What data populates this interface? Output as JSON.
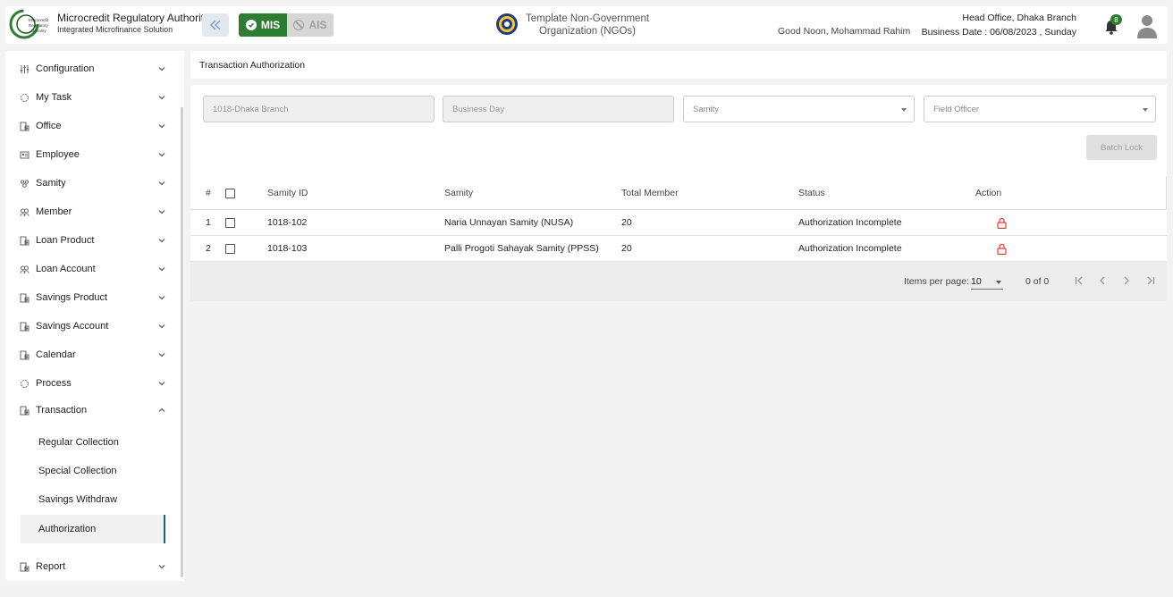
{
  "header": {
    "brand_title": "Microcredit Regulatory Authority",
    "brand_subtitle": "Integrated Microfinance Solution",
    "logo_text": "Microcredit Regulatory Authority",
    "mode_mis": "MIS",
    "mode_ais": "AIS",
    "org_line1": "Template Non-Government",
    "org_line2": "Organization (NGOs)",
    "greeting": "Good Noon, Mohammad Rahim",
    "office": "Head Office, Dhaka Branch",
    "business_date": "Business Date : 06/08/2023 , Sunday",
    "notification_count": "8",
    "colors": {
      "brand_green": "#2e7d32",
      "active_bar": "#1f5e94",
      "lock_red": "#e53935"
    }
  },
  "sidebar": {
    "items": [
      {
        "label": "Configuration",
        "icon": "sliders-icon"
      },
      {
        "label": "My Task",
        "icon": "spinner-icon"
      },
      {
        "label": "Office",
        "icon": "building-icon"
      },
      {
        "label": "Employee",
        "icon": "id-card-icon"
      },
      {
        "label": "Samity",
        "icon": "group-icon"
      },
      {
        "label": "Member",
        "icon": "users-icon"
      },
      {
        "label": "Loan Product",
        "icon": "building-icon"
      },
      {
        "label": "Loan Account",
        "icon": "users-icon"
      },
      {
        "label": "Savings Product",
        "icon": "building-icon"
      },
      {
        "label": "Savings Account",
        "icon": "building-icon"
      },
      {
        "label": "Calendar",
        "icon": "building-icon"
      },
      {
        "label": "Process",
        "icon": "spinner-icon"
      },
      {
        "label": "Transaction",
        "icon": "building-icon"
      }
    ],
    "transaction_sub": [
      {
        "label": "Regular Collection"
      },
      {
        "label": "Special Collection"
      },
      {
        "label": "Savings Withdraw"
      },
      {
        "label": "Authorization"
      }
    ],
    "report": {
      "label": "Report",
      "icon": "building-icon"
    }
  },
  "page": {
    "breadcrumb": "Transaction Authorization",
    "filters": {
      "branch": "1018-Dhaka Branch",
      "business_day": "Business Day",
      "samity_placeholder": "Samity",
      "field_officer_placeholder": "Field Officer"
    },
    "batch_lock": "Batch Lock"
  },
  "table": {
    "headers": {
      "index": "#",
      "samity_id": "Samity ID",
      "samity": "Samity",
      "total_member": "Total Member",
      "status": "Status",
      "action": "Action"
    },
    "rows": [
      {
        "index": "1",
        "samity_id": "1018-102",
        "samity": "Naria Unnayan Samity (NUSA)",
        "total_member": "20",
        "status": "Authorization Incomplete"
      },
      {
        "index": "2",
        "samity_id": "1018-103",
        "samity": "Palli Progoti Sahayak Samity (PPSS)",
        "total_member": "20",
        "status": "Authorization Incomplete"
      }
    ]
  },
  "paginator": {
    "items_per_page_label": "Items per page:",
    "page_size": "10",
    "range": "0 of 0"
  }
}
